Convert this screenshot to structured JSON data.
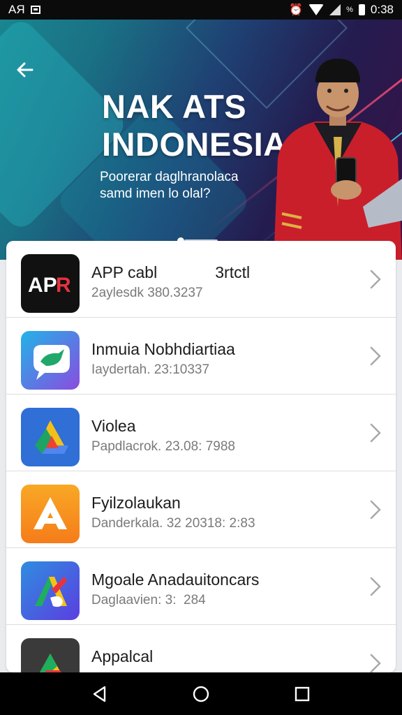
{
  "status_bar": {
    "left_text": "AЯ",
    "battery_pct": "%",
    "time": "0:38",
    "icons": [
      "notification-icon",
      "alarm-icon",
      "wifi-icon",
      "signal-icon",
      "battery-icon"
    ]
  },
  "banner": {
    "title": "NAK ATS\nINDONESIA",
    "subtitle": "Poorerar daglhranolaca\nsamd imen lo olal?",
    "colors": {
      "start": "#19868f",
      "mid": "#1f3f72",
      "end": "#3a1145"
    }
  },
  "apps": [
    {
      "icon": "apr-icon",
      "name": "APP cabl             3rtctl",
      "meta": "2aylesdk 380.3237",
      "color": "#111111"
    },
    {
      "icon": "chat-bubble-icon",
      "name": "Inmuia Nobhdiartiaa",
      "meta": "Iaydertah. 23:10337",
      "color": "#2aa6e8"
    },
    {
      "icon": "drive-triangle-icon",
      "name": "Violea",
      "meta": "Papdlacrok. 23.08: 7988",
      "color": "#2f6fd6"
    },
    {
      "icon": "letter-a-icon",
      "name": "Fyilzolaukan",
      "meta": "Danderkala. 32 20318: 2:83",
      "color": "#f59a1a"
    },
    {
      "icon": "multicolor-a-icon",
      "name": "Mgoale Anadauitoncars",
      "meta": "Daglaavien: 3:  284",
      "color": "#3a5be0"
    },
    {
      "icon": "triangle-icon",
      "name": "Appalcal",
      "meta": "",
      "color": "#3a3a3a"
    }
  ],
  "nav": {
    "buttons": [
      "back-triangle-icon",
      "home-circle-icon",
      "recents-square-icon"
    ]
  }
}
